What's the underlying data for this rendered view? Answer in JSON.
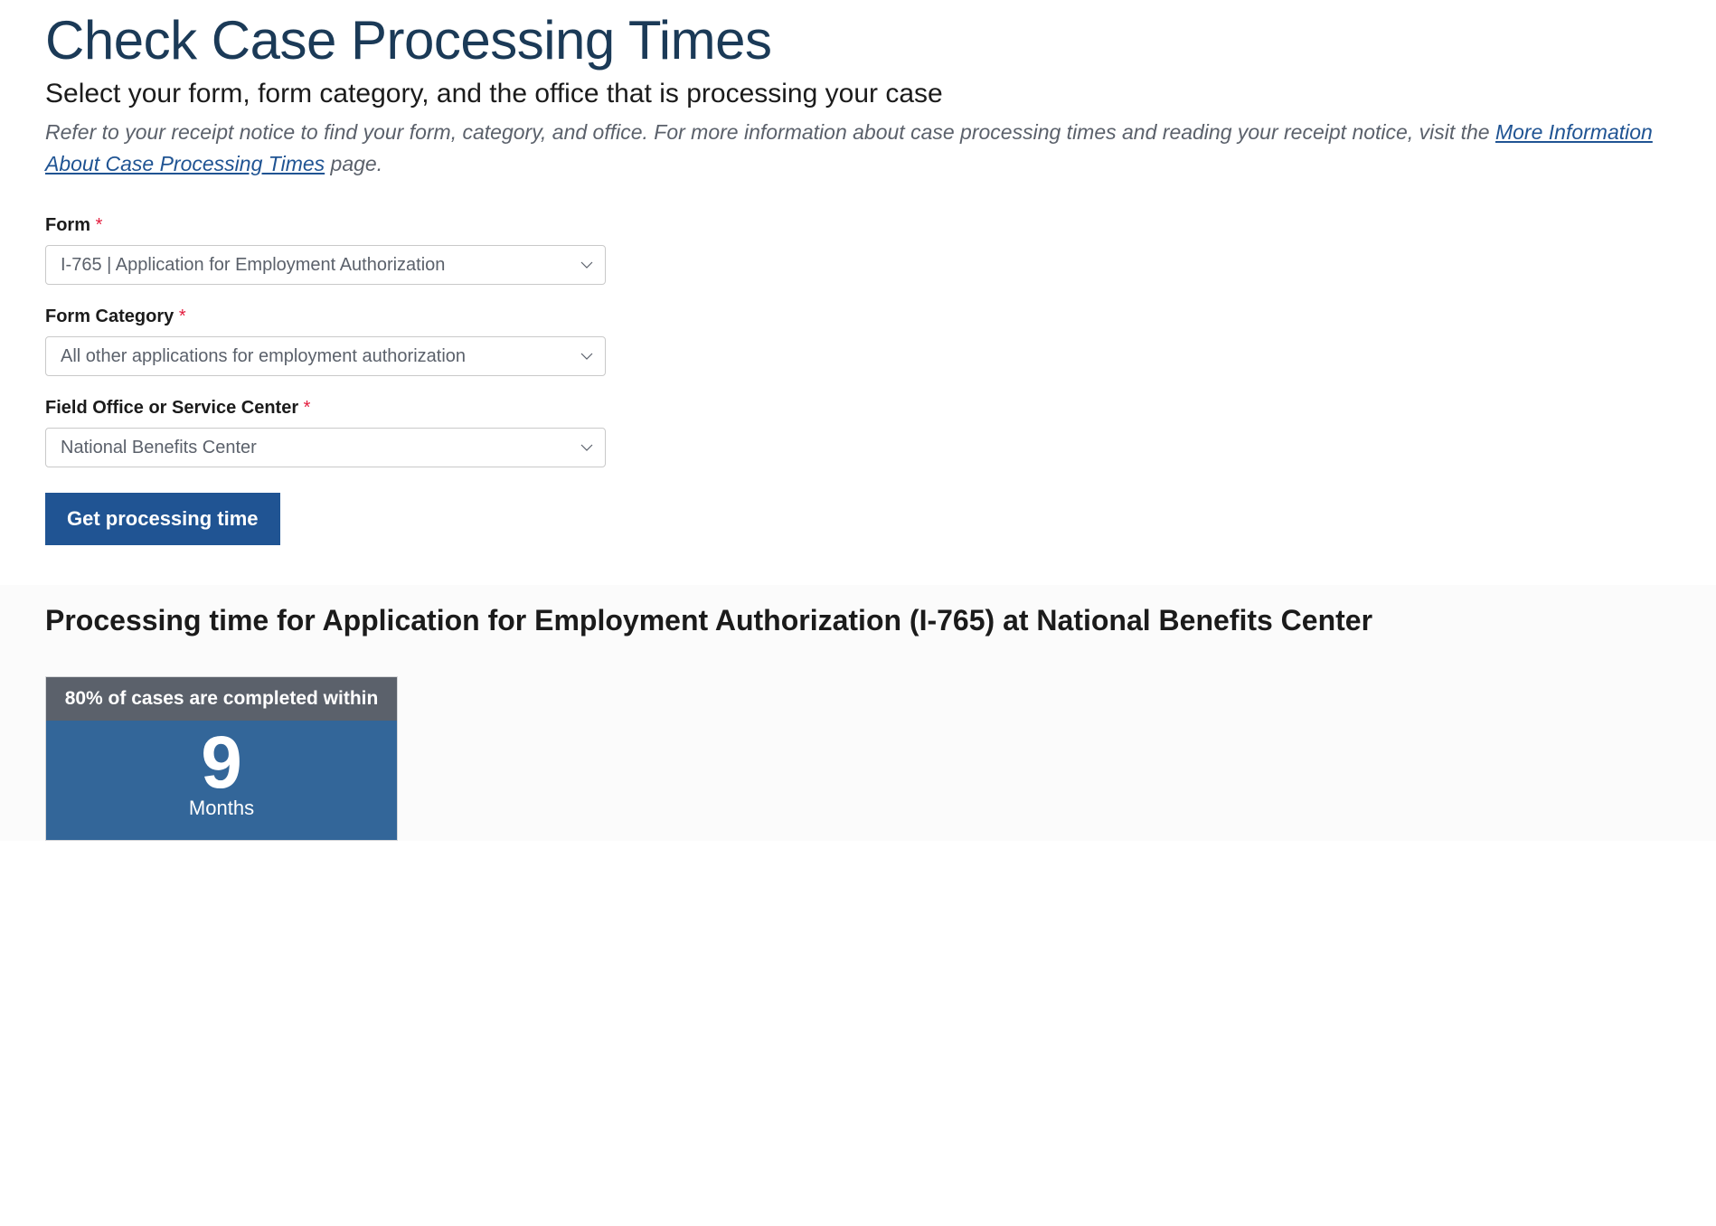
{
  "header": {
    "title": "Check Case Processing Times",
    "subtitle": "Select your form, form category, and the office that is processing your case",
    "intro_prefix": "Refer to your receipt notice to find your form, category, and office. For more information about case processing times and reading your receipt notice, visit the ",
    "intro_link_text": "More Information About Case Processing Times",
    "intro_suffix": " page."
  },
  "form": {
    "form_field": {
      "label": "Form",
      "value": "I-765 | Application for Employment Authorization"
    },
    "category_field": {
      "label": "Form Category",
      "value": "All other applications for employment authorization"
    },
    "office_field": {
      "label": "Field Office or Service Center",
      "value": "National Benefits Center"
    },
    "submit_label": "Get processing time"
  },
  "results": {
    "heading": "Processing time for Application for Employment Authorization (I-765) at National Benefits Center",
    "card": {
      "header": "80% of cases are completed within",
      "number": "9",
      "unit": "Months"
    }
  }
}
